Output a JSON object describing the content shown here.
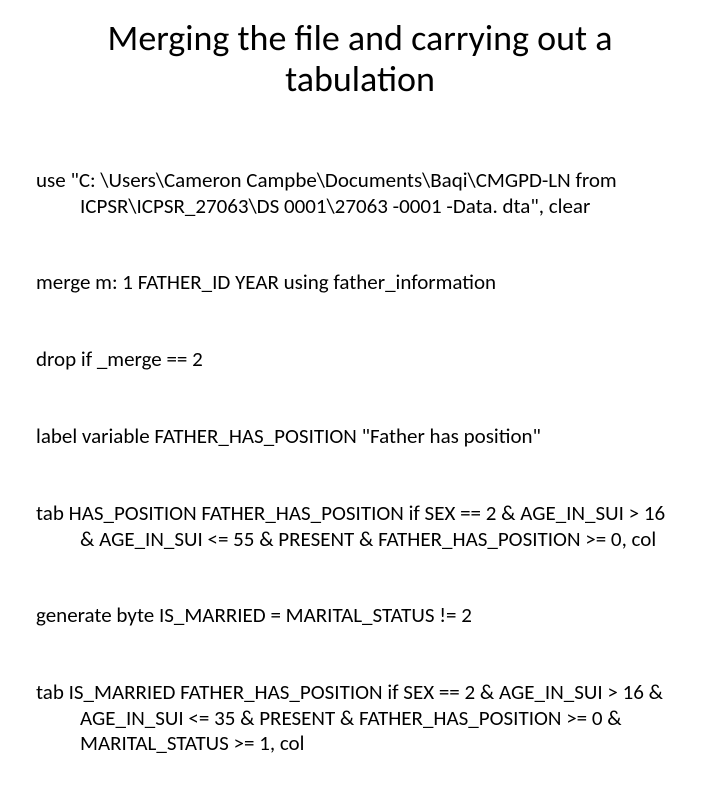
{
  "title": "Merging the file and carrying out a tabulation",
  "lines": [
    "use \"C: \\Users\\Cameron Campbe\\Documents\\Baqi\\CMGPD-LN from ICPSR\\ICPSR_27063\\DS 0001\\27063 -0001 -Data. dta\", clear",
    "merge m: 1 FATHER_ID YEAR using father_information",
    "drop if _merge == 2",
    "label variable FATHER_HAS_POSITION \"Father has position\"",
    "tab HAS_POSITION FATHER_HAS_POSITION if SEX == 2 & AGE_IN_SUI > 16 & AGE_IN_SUI <= 55 & PRESENT & FATHER_HAS_POSITION >= 0, col",
    "generate byte IS_MARRIED = MARITAL_STATUS != 2",
    "tab IS_MARRIED FATHER_HAS_POSITION if SEX == 2 & AGE_IN_SUI > 16 & AGE_IN_SUI <= 35 & PRESENT & FATHER_HAS_POSITION >= 0 & MARITAL_STATUS >= 1, col"
  ]
}
